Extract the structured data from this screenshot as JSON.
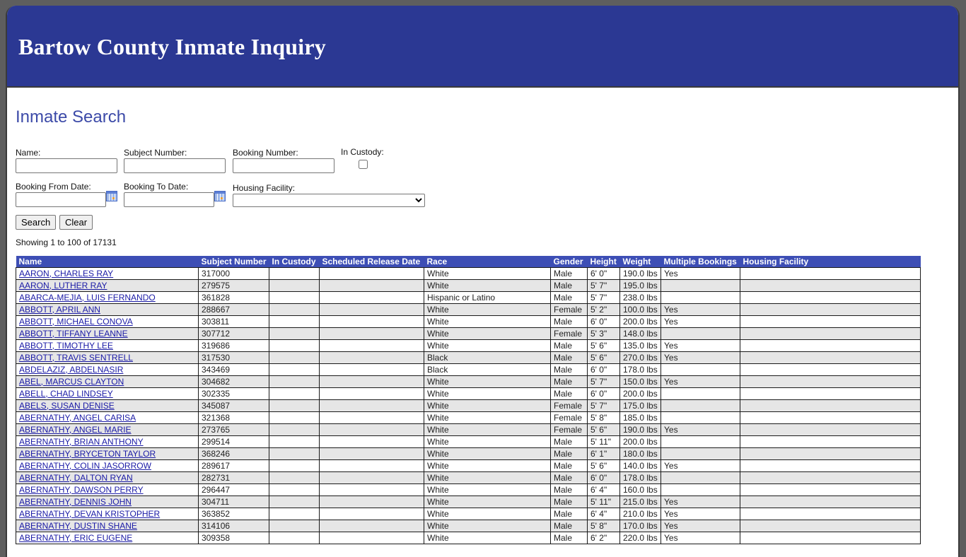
{
  "header": {
    "title": "Bartow County Inmate Inquiry"
  },
  "page": {
    "title": "Inmate Search"
  },
  "form": {
    "name_label": "Name:",
    "name_value": "",
    "subject_label": "Subject Number:",
    "subject_value": "",
    "booking_label": "Booking Number:",
    "booking_value": "",
    "custody_label": "In Custody:",
    "custody_checked": false,
    "from_label": "Booking From Date:",
    "from_value": "",
    "to_label": "Booking To Date:",
    "to_value": "",
    "facility_label": "Housing Facility:",
    "facility_value": "",
    "search_button": "Search",
    "clear_button": "Clear",
    "calendar_icon": "calendar-icon"
  },
  "status": {
    "showing": "Showing 1 to 100 of 17131"
  },
  "table": {
    "columns": [
      "Name",
      "Subject Number",
      "In Custody",
      "Scheduled Release Date",
      "Race",
      "Gender",
      "Height",
      "Weight",
      "Multiple Bookings",
      "Housing Facility"
    ],
    "rows": [
      {
        "name": "AARON, CHARLES RAY",
        "subject": "317000",
        "custody": "",
        "release": "",
        "race": "White",
        "gender": "Male",
        "height": "6' 0\"",
        "weight": "190.0 lbs",
        "multiple": "Yes",
        "facility": ""
      },
      {
        "name": "AARON, LUTHER RAY",
        "subject": "279575",
        "custody": "",
        "release": "",
        "race": "White",
        "gender": "Male",
        "height": "5' 7\"",
        "weight": "195.0 lbs",
        "multiple": "",
        "facility": ""
      },
      {
        "name": "ABARCA-MEJIA, LUIS FERNANDO",
        "subject": "361828",
        "custody": "",
        "release": "",
        "race": "Hispanic or Latino",
        "gender": "Male",
        "height": "5' 7\"",
        "weight": "238.0 lbs",
        "multiple": "",
        "facility": ""
      },
      {
        "name": "ABBOTT, APRIL ANN",
        "subject": "288667",
        "custody": "",
        "release": "",
        "race": "White",
        "gender": "Female",
        "height": "5' 2\"",
        "weight": "100.0 lbs",
        "multiple": "Yes",
        "facility": ""
      },
      {
        "name": "ABBOTT, MICHAEL CONOVA",
        "subject": "303811",
        "custody": "",
        "release": "",
        "race": "White",
        "gender": "Male",
        "height": "6' 0\"",
        "weight": "200.0 lbs",
        "multiple": "Yes",
        "facility": ""
      },
      {
        "name": "ABBOTT, TIFFANY LEANNE",
        "subject": "307712",
        "custody": "",
        "release": "",
        "race": "White",
        "gender": "Female",
        "height": "5' 3\"",
        "weight": "148.0 lbs",
        "multiple": "",
        "facility": ""
      },
      {
        "name": "ABBOTT, TIMOTHY LEE",
        "subject": "319686",
        "custody": "",
        "release": "",
        "race": "White",
        "gender": "Male",
        "height": "5' 6\"",
        "weight": "135.0 lbs",
        "multiple": "Yes",
        "facility": ""
      },
      {
        "name": "ABBOTT, TRAVIS SENTRELL",
        "subject": "317530",
        "custody": "",
        "release": "",
        "race": "Black",
        "gender": "Male",
        "height": "5' 6\"",
        "weight": "270.0 lbs",
        "multiple": "Yes",
        "facility": ""
      },
      {
        "name": "ABDELAZIZ, ABDELNASIR",
        "subject": "343469",
        "custody": "",
        "release": "",
        "race": "Black",
        "gender": "Male",
        "height": "6' 0\"",
        "weight": "178.0 lbs",
        "multiple": "",
        "facility": ""
      },
      {
        "name": "ABEL, MARCUS CLAYTON",
        "subject": "304682",
        "custody": "",
        "release": "",
        "race": "White",
        "gender": "Male",
        "height": "5' 7\"",
        "weight": "150.0 lbs",
        "multiple": "Yes",
        "facility": ""
      },
      {
        "name": "ABELL, CHAD LINDSEY",
        "subject": "302335",
        "custody": "",
        "release": "",
        "race": "White",
        "gender": "Male",
        "height": "6' 0\"",
        "weight": "200.0 lbs",
        "multiple": "",
        "facility": ""
      },
      {
        "name": "ABELS, SUSAN DENISE",
        "subject": "345087",
        "custody": "",
        "release": "",
        "race": "White",
        "gender": "Female",
        "height": "5' 7\"",
        "weight": "175.0 lbs",
        "multiple": "",
        "facility": ""
      },
      {
        "name": "ABERNATHY, ANGEL CARISA",
        "subject": "321368",
        "custody": "",
        "release": "",
        "race": "White",
        "gender": "Female",
        "height": "5' 8\"",
        "weight": "185.0 lbs",
        "multiple": "",
        "facility": ""
      },
      {
        "name": "ABERNATHY, ANGEL MARIE",
        "subject": "273765",
        "custody": "",
        "release": "",
        "race": "White",
        "gender": "Female",
        "height": "5' 6\"",
        "weight": "190.0 lbs",
        "multiple": "Yes",
        "facility": ""
      },
      {
        "name": "ABERNATHY, BRIAN ANTHONY",
        "subject": "299514",
        "custody": "",
        "release": "",
        "race": "White",
        "gender": "Male",
        "height": "5' 11\"",
        "weight": "200.0 lbs",
        "multiple": "",
        "facility": ""
      },
      {
        "name": "ABERNATHY, BRYCETON TAYLOR",
        "subject": "368246",
        "custody": "",
        "release": "",
        "race": "White",
        "gender": "Male",
        "height": "6' 1\"",
        "weight": "180.0 lbs",
        "multiple": "",
        "facility": ""
      },
      {
        "name": "ABERNATHY, COLIN JASORROW",
        "subject": "289617",
        "custody": "",
        "release": "",
        "race": "White",
        "gender": "Male",
        "height": "5' 6\"",
        "weight": "140.0 lbs",
        "multiple": "Yes",
        "facility": ""
      },
      {
        "name": "ABERNATHY, DALTON RYAN",
        "subject": "282731",
        "custody": "",
        "release": "",
        "race": "White",
        "gender": "Male",
        "height": "6' 0\"",
        "weight": "178.0 lbs",
        "multiple": "",
        "facility": ""
      },
      {
        "name": "ABERNATHY, DAWSON PERRY",
        "subject": "296447",
        "custody": "",
        "release": "",
        "race": "White",
        "gender": "Male",
        "height": "6' 4\"",
        "weight": "160.0 lbs",
        "multiple": "",
        "facility": ""
      },
      {
        "name": "ABERNATHY, DENNIS JOHN",
        "subject": "304711",
        "custody": "",
        "release": "",
        "race": "White",
        "gender": "Male",
        "height": "5' 11\"",
        "weight": "215.0 lbs",
        "multiple": "Yes",
        "facility": ""
      },
      {
        "name": "ABERNATHY, DEVAN KRISTOPHER",
        "subject": "363852",
        "custody": "",
        "release": "",
        "race": "White",
        "gender": "Male",
        "height": "6' 4\"",
        "weight": "210.0 lbs",
        "multiple": "Yes",
        "facility": ""
      },
      {
        "name": "ABERNATHY, DUSTIN SHANE",
        "subject": "314106",
        "custody": "",
        "release": "",
        "race": "White",
        "gender": "Male",
        "height": "5' 8\"",
        "weight": "170.0 lbs",
        "multiple": "Yes",
        "facility": ""
      },
      {
        "name": "ABERNATHY, ERIC EUGENE",
        "subject": "309358",
        "custody": "",
        "release": "",
        "race": "White",
        "gender": "Male",
        "height": "6' 2\"",
        "weight": "220.0 lbs",
        "multiple": "Yes",
        "facility": ""
      }
    ]
  }
}
